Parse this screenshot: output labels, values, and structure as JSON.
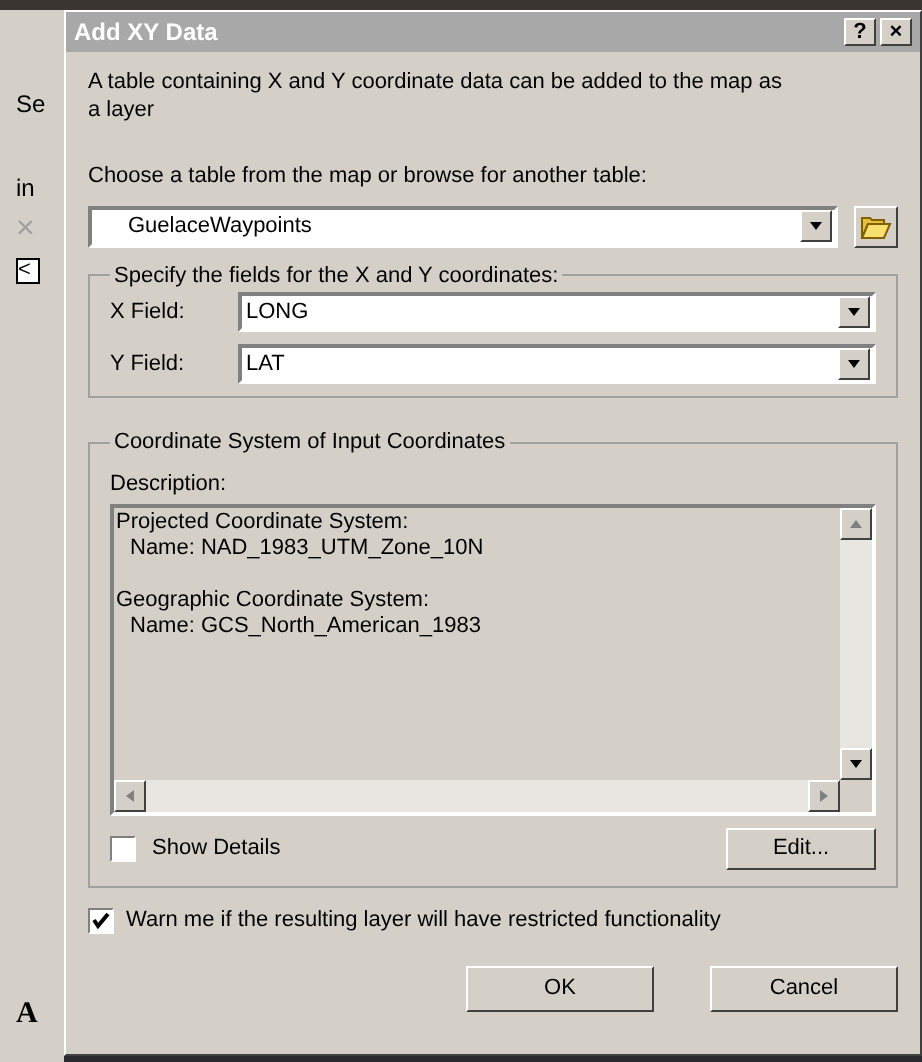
{
  "background_app": {
    "fragments": [
      "Se",
      "in",
      "×",
      "<",
      "A"
    ]
  },
  "window": {
    "title": "Add XY Data",
    "help_button": "?",
    "close_button": "×"
  },
  "intro": "A table containing X and Y coordinate data can be added to the map as a layer",
  "table_prompt": "Choose a table from the map or browse for another table:",
  "table_select": {
    "value": "GuelaceWaypoints"
  },
  "fields_group": {
    "legend": "Specify the fields for the X and Y coordinates:",
    "fields": [
      {
        "label": "X Field:",
        "value": "LONG"
      },
      {
        "label": "Y Field:",
        "value": "LAT"
      }
    ]
  },
  "coordinate_group": {
    "legend": "Coordinate System of Input Coordinates",
    "description_label": "Description:",
    "description_blocks": [
      {
        "heading": "Projected Coordinate System:",
        "name": "Name: NAD_1983_UTM_Zone_10N"
      },
      {
        "heading": "Geographic Coordinate System:",
        "name": "Name: GCS_North_American_1983"
      }
    ],
    "show_details": {
      "label": "Show Details",
      "checked": false
    },
    "edit_button": "Edit..."
  },
  "warn_checkbox": {
    "label": "Warn me if the resulting layer will have restricted functionality",
    "checked": true
  },
  "buttons": [
    "OK",
    "Cancel"
  ]
}
